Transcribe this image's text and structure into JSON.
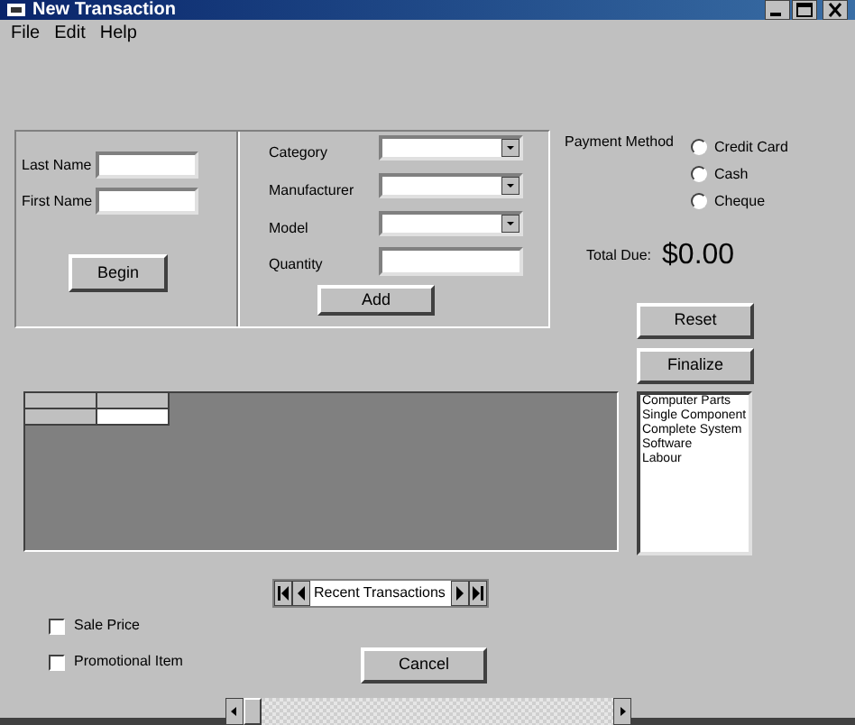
{
  "window": {
    "title": "New Transaction"
  },
  "menu": [
    "File",
    "Edit",
    "Help"
  ],
  "customer": {
    "fields": [
      {
        "label": "Last Name"
      },
      {
        "label": "First Name"
      }
    ],
    "button": "Begin"
  },
  "item": {
    "fields": [
      {
        "label": "Category",
        "kind": "combo"
      },
      {
        "label": "Manufacturer",
        "kind": "combo"
      },
      {
        "label": "Model",
        "kind": "combo"
      },
      {
        "label": "Quantity",
        "kind": "text"
      }
    ],
    "button": "Add"
  },
  "payment": {
    "label": "Payment Method",
    "options": [
      {
        "label": "Credit Card",
        "selected": false
      },
      {
        "label": "Cash",
        "selected": false
      },
      {
        "label": "Cheque",
        "selected": false
      }
    ]
  },
  "total": {
    "label": "Total Due:",
    "value": "$0.00"
  },
  "actions": [
    "Reset",
    "Finalize"
  ],
  "list": {
    "items": [
      "Computer Parts",
      "Single Component",
      "Complete System",
      "Software",
      "Labour"
    ]
  },
  "navigator": {
    "caption": "Recent Transactions"
  },
  "options": [
    {
      "label": "Sale Price",
      "checked": false
    },
    {
      "label": "Promotional Item",
      "checked": false
    }
  ],
  "cancel": "Cancel"
}
